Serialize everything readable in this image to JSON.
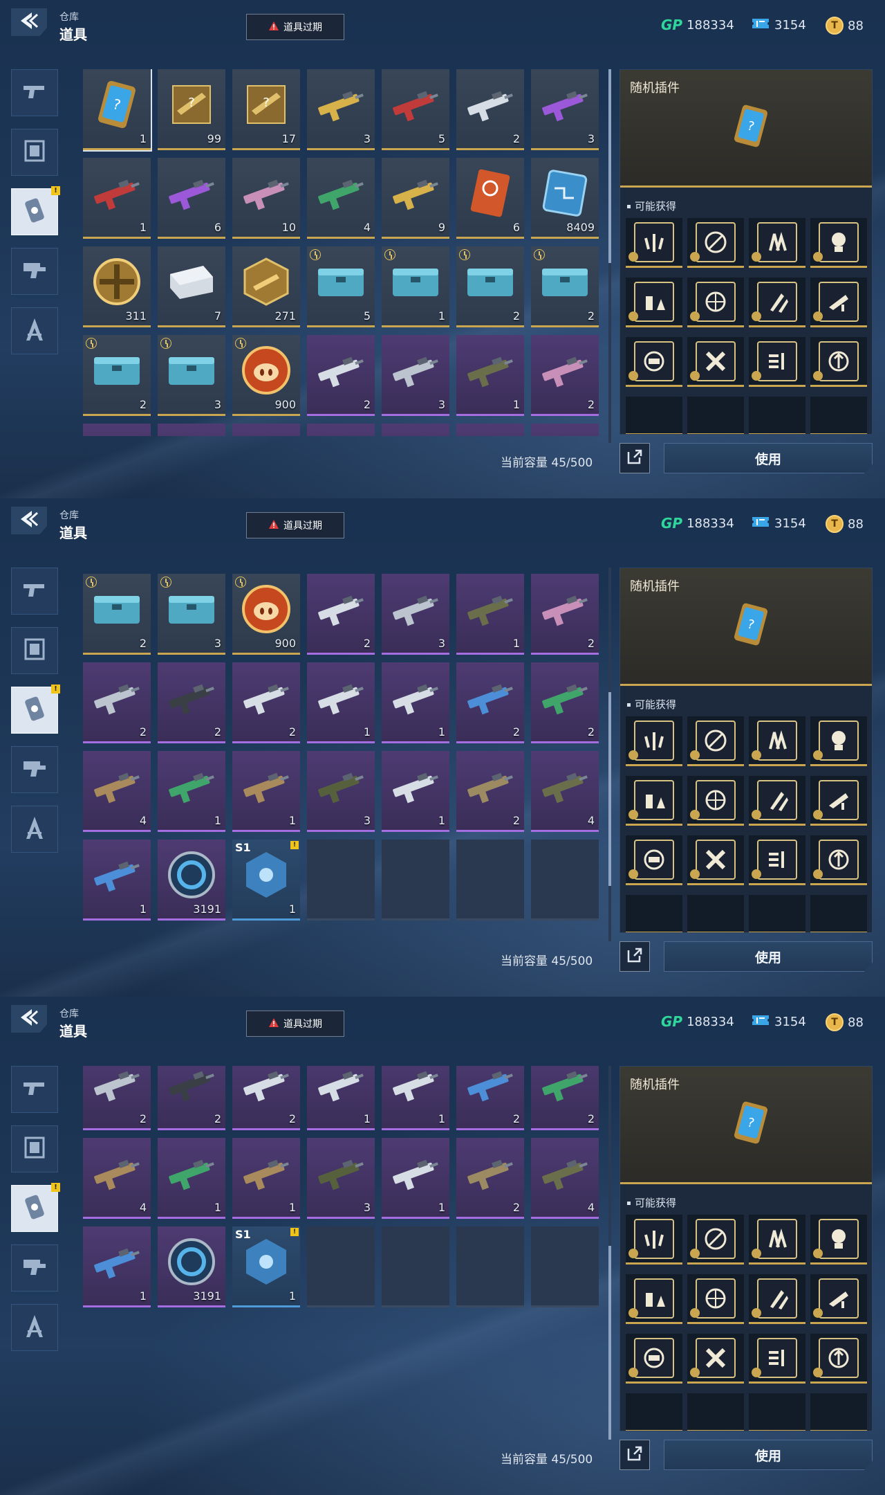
{
  "header": {
    "crumb_small": "仓库",
    "crumb_big": "道具",
    "expire_button": "道具过期",
    "gp_label": "GP",
    "gp_value": "188334",
    "ticket_value": "3154",
    "coin_value": "88"
  },
  "sidebar": {
    "tabs": [
      {
        "icon": "pistol-icon",
        "active": false,
        "badge": ""
      },
      {
        "icon": "frame-icon",
        "active": false,
        "badge": ""
      },
      {
        "icon": "chip-card-icon",
        "active": true,
        "badge": "!"
      },
      {
        "icon": "gun-part-icon",
        "active": false,
        "badge": ""
      },
      {
        "icon": "compass-icon",
        "active": false,
        "badge": ""
      }
    ]
  },
  "items": [
    {
      "count": "1",
      "rarity": "gold",
      "icon": "random-plugin-card-icon",
      "timer": false
    },
    {
      "count": "99",
      "rarity": "gold",
      "icon": "mystery-weapon-box-icon",
      "timer": false
    },
    {
      "count": "17",
      "rarity": "gold",
      "icon": "mystery-weapon-box-icon",
      "timer": false
    },
    {
      "count": "3",
      "rarity": "gold",
      "icon": "gold-smg-icon",
      "timer": false
    },
    {
      "count": "5",
      "rarity": "gold",
      "icon": "red-rifle-icon",
      "timer": false
    },
    {
      "count": "2",
      "rarity": "gold",
      "icon": "white-rifle-icon",
      "timer": false
    },
    {
      "count": "3",
      "rarity": "gold",
      "icon": "purple-rifle-icon",
      "timer": false
    },
    {
      "count": "1",
      "rarity": "gold",
      "icon": "red-black-rifle-icon",
      "timer": false
    },
    {
      "count": "6",
      "rarity": "gold",
      "icon": "purple-sniper-icon",
      "timer": false
    },
    {
      "count": "10",
      "rarity": "gold",
      "icon": "pink-rifle-icon",
      "timer": false
    },
    {
      "count": "4",
      "rarity": "gold",
      "icon": "green-rifle-icon",
      "timer": false
    },
    {
      "count": "9",
      "rarity": "gold",
      "icon": "gold-rifle-icon",
      "timer": false
    },
    {
      "count": "6",
      "rarity": "gold",
      "icon": "orange-card-icon",
      "timer": false
    },
    {
      "count": "8409",
      "rarity": "gold",
      "icon": "circuit-chip-icon",
      "timer": false
    },
    {
      "count": "311",
      "rarity": "gold",
      "icon": "gold-medal-icon",
      "timer": false
    },
    {
      "count": "7",
      "rarity": "gold",
      "icon": "silver-case-icon",
      "timer": false
    },
    {
      "count": "271",
      "rarity": "gold",
      "icon": "gold-crate-icon",
      "timer": false
    },
    {
      "count": "5",
      "rarity": "gold",
      "icon": "teal-chest-icon",
      "timer": true
    },
    {
      "count": "1",
      "rarity": "gold",
      "icon": "teal-chest-icon",
      "timer": true
    },
    {
      "count": "2",
      "rarity": "gold",
      "icon": "teal-chest-icon",
      "timer": true
    },
    {
      "count": "2",
      "rarity": "gold",
      "icon": "teal-chest-icon",
      "timer": true
    },
    {
      "count": "2",
      "rarity": "gold",
      "icon": "teal-chest-icon",
      "timer": true
    },
    {
      "count": "3",
      "rarity": "gold",
      "icon": "teal-chest-icon",
      "timer": true
    },
    {
      "count": "900",
      "rarity": "gold",
      "icon": "pig-coin-icon",
      "timer": true
    },
    {
      "count": "2",
      "rarity": "purple",
      "icon": "white-smg-icon",
      "timer": false
    },
    {
      "count": "3",
      "rarity": "purple",
      "icon": "silver-rifle-icon",
      "timer": false
    },
    {
      "count": "1",
      "rarity": "purple",
      "icon": "camo-rifle-icon",
      "timer": false
    },
    {
      "count": "2",
      "rarity": "purple",
      "icon": "pink-smg-icon",
      "timer": false
    },
    {
      "count": "2",
      "rarity": "purple",
      "icon": "silver-shotgun-icon",
      "timer": false
    },
    {
      "count": "2",
      "rarity": "purple",
      "icon": "black-rifle-icon",
      "timer": false
    },
    {
      "count": "2",
      "rarity": "purple",
      "icon": "white-sniper-icon",
      "timer": false
    },
    {
      "count": "1",
      "rarity": "purple",
      "icon": "white-carbine-icon",
      "timer": false
    },
    {
      "count": "1",
      "rarity": "purple",
      "icon": "white-bow-icon",
      "timer": false
    },
    {
      "count": "2",
      "rarity": "purple",
      "icon": "blue-bow-icon",
      "timer": false
    },
    {
      "count": "2",
      "rarity": "purple",
      "icon": "green-shotgun-icon",
      "timer": false
    },
    {
      "count": "4",
      "rarity": "purple",
      "icon": "tan-rifle-icon",
      "timer": false
    },
    {
      "count": "1",
      "rarity": "purple",
      "icon": "green-pistol-icon",
      "timer": false
    },
    {
      "count": "1",
      "rarity": "purple",
      "icon": "tan-pistol-icon",
      "timer": false
    },
    {
      "count": "3",
      "rarity": "purple",
      "icon": "olive-smg-icon",
      "timer": false
    },
    {
      "count": "1",
      "rarity": "purple",
      "icon": "white-lmg-icon",
      "timer": false
    },
    {
      "count": "2",
      "rarity": "purple",
      "icon": "desert-rifle-icon",
      "timer": false
    },
    {
      "count": "4",
      "rarity": "purple",
      "icon": "camo-lmg-icon",
      "timer": false
    },
    {
      "count": "1",
      "rarity": "purple",
      "icon": "blue-rifle-icon",
      "timer": false
    },
    {
      "count": "3191",
      "rarity": "purple",
      "icon": "blue-ring-icon",
      "timer": false
    },
    {
      "count": "1",
      "rarity": "blue",
      "icon": "blue-core-icon",
      "timer": false,
      "tag": "S1",
      "badge": "!"
    }
  ],
  "capacity": "当前容量 45/500",
  "detail": {
    "title": "随机插件",
    "possible_label": "可能获得",
    "rewards": [
      "wings-plugin-icon",
      "no-fire-plugin-icon",
      "boost-plugin-icon",
      "grenade-plugin-icon",
      "battery-plugin-icon",
      "target-plugin-icon",
      "ammo-plugin-icon",
      "rifle-plugin-icon",
      "magazine-plugin-icon",
      "cross-plugin-icon",
      "stack-plugin-icon",
      "shield-plugin-icon"
    ]
  },
  "use_button": "使用",
  "colors": {
    "gold": "#c9a64f",
    "purple": "#a56ee0",
    "blue": "#4f9bd9",
    "gp": "#2fd79a"
  }
}
